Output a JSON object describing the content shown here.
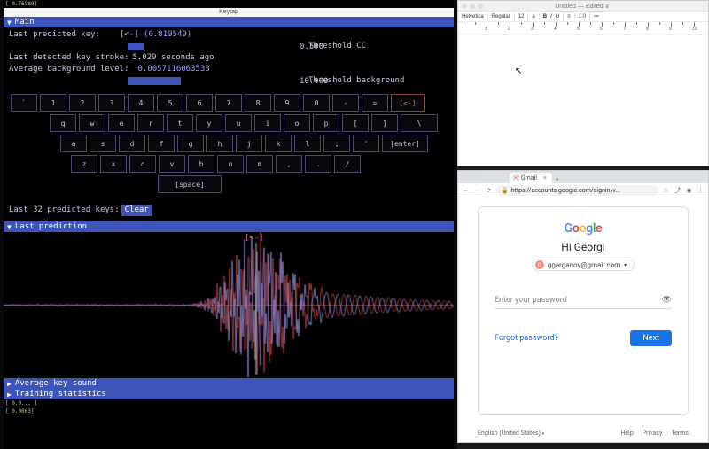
{
  "left": {
    "status_top": "[ 0.76989]",
    "status_bottom_1": "[ 0.0... ]",
    "status_bottom_2": "[ 0.0063]",
    "window_title": "Keytap",
    "main_header": "Main",
    "last_predicted_key_label": "Last predicted key:",
    "last_predicted_key_value": "[<-] (0.819549)",
    "threshold_cc_value": "0.500",
    "threshold_cc_label": "Threshold CC",
    "last_detected_label": "Last detected key stroke:",
    "last_detected_value": "5.029 seconds ago",
    "avg_bg_label": "Average background level:",
    "avg_bg_value": "0.0057116063533",
    "threshold_bg_value": "10.000",
    "threshold_bg_label": "Threshold background",
    "keyboard": {
      "row1": [
        "`",
        "1",
        "2",
        "3",
        "4",
        "5",
        "6",
        "7",
        "8",
        "9",
        "0",
        "-",
        "=",
        "[<-]"
      ],
      "row2": [
        "q",
        "w",
        "e",
        "r",
        "t",
        "y",
        "u",
        "i",
        "o",
        "p",
        "[",
        "]",
        "\\"
      ],
      "row3": [
        "a",
        "s",
        "d",
        "f",
        "g",
        "h",
        "j",
        "k",
        "l",
        ";",
        "'",
        "[enter]"
      ],
      "row4": [
        "z",
        "x",
        "c",
        "v",
        "b",
        "n",
        "m",
        ",",
        ".",
        "/"
      ],
      "space": "[space]"
    },
    "last32_label": "Last 32 predicted keys:",
    "clear_btn": "Clear",
    "last_prediction_header": "Last prediction",
    "wave_top_label": "[<-]",
    "avg_key_sound_header": "Average key sound",
    "training_stats_header": "Training statistics"
  },
  "editor": {
    "title": "Untitled — Edited ∨",
    "font": "Helvetica",
    "style": "Regular",
    "size": "12",
    "align": "≡",
    "spacing": "1.0"
  },
  "browser": {
    "tab_title": "Gmail",
    "url": "https://accounts.google.com/signin/v...",
    "greeting": "Hi Georgi",
    "email": "ggerganov@gmail.com",
    "pw_placeholder": "Enter your password",
    "forgot": "Forgot password?",
    "next": "Next",
    "lang": "English (United States)",
    "footer": [
      "Help",
      "Privacy",
      "Terms"
    ]
  }
}
